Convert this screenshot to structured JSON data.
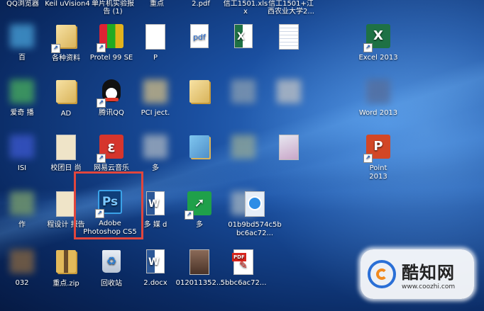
{
  "top_labels": [
    {
      "text": "QQ浏览器"
    },
    {
      "text": "Keil uVision4"
    },
    {
      "text": "单片机实验报"
    },
    {
      "text": "告 (1)"
    },
    {
      "text": "重点"
    },
    {
      "text": "2.pdf"
    },
    {
      "text": "信工1501.xls"
    },
    {
      "text": "x"
    },
    {
      "text": "信工1501+江"
    },
    {
      "text": "西农业大学2..."
    }
  ],
  "icons": {
    "r1c1": {
      "label": "百"
    },
    "r1c2": {
      "label": "各种资料"
    },
    "r1c3": {
      "label": "Protel 99 SE"
    },
    "r1c4": {
      "label": "P"
    },
    "r1c9": {
      "label": "Excel 2013"
    },
    "r2c1": {
      "label": "爱奇   播"
    },
    "r2c2": {
      "label": "AD"
    },
    "r2c3": {
      "label": "腾讯QQ"
    },
    "r2c4": {
      "label": "PCI     ject."
    },
    "r2c9": {
      "label": "Word 2013"
    },
    "r3c1": {
      "label": "ISI"
    },
    "r3c2": {
      "label": "校团日  尚"
    },
    "r3c3": {
      "label": "网易云音乐"
    },
    "r3c4": {
      "label": "多"
    },
    "r3c9": {
      "label": "Point\n2013"
    },
    "r4c1": {
      "label": "作"
    },
    "r4c2": {
      "label": "程设计  报告"
    },
    "r4c3": {
      "label": "Adobe Photoshop CS5"
    },
    "r4c4": {
      "label": "多 媒      d"
    },
    "r4c5": {
      "label": "多"
    },
    "r4c7": {
      "label": "01b9bd574c5bbc6ac72..."
    },
    "r5c1": {
      "label": "032"
    },
    "r5c2": {
      "label": "重点.zip"
    },
    "r5c3": {
      "label": "回收站"
    },
    "r5c4": {
      "label": "2.docx"
    },
    "r5c5": {
      "label": "012011352..."
    },
    "r5c7": {
      "label": "5bbc6ac72..."
    }
  },
  "watermark": {
    "name": "酷知网",
    "url": "www.coozhi.com"
  },
  "colors": {
    "highlight": "#e0463d",
    "excel": "#1e7145",
    "word": "#2b5797",
    "ppt": "#d24726",
    "ps": "#0f6fb5"
  }
}
